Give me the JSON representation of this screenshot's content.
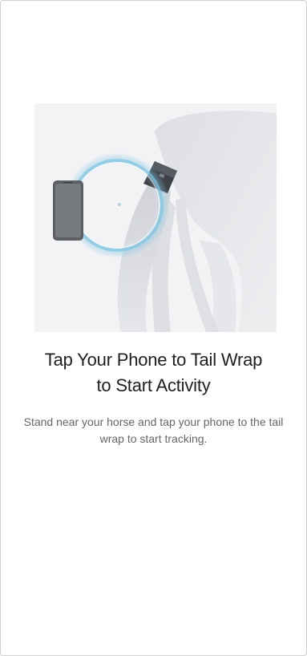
{
  "screen": {
    "title_line_1": "Tap Your Phone to Tail Wrap",
    "title_line_2": "to Start Activity",
    "description": "Stand near your horse and tap your phone to the tail wrap to start tracking."
  },
  "illustration": {
    "icons": [
      "phone-icon",
      "nfc-ring-icon",
      "horse-tail-icon",
      "tail-wrap-device-icon"
    ]
  },
  "colors": {
    "background": "#ffffff",
    "illustration_background": "#f3f3f5",
    "title": "#1f1f1f",
    "description": "#666666",
    "nfc_ring": "#6fbfe0"
  }
}
